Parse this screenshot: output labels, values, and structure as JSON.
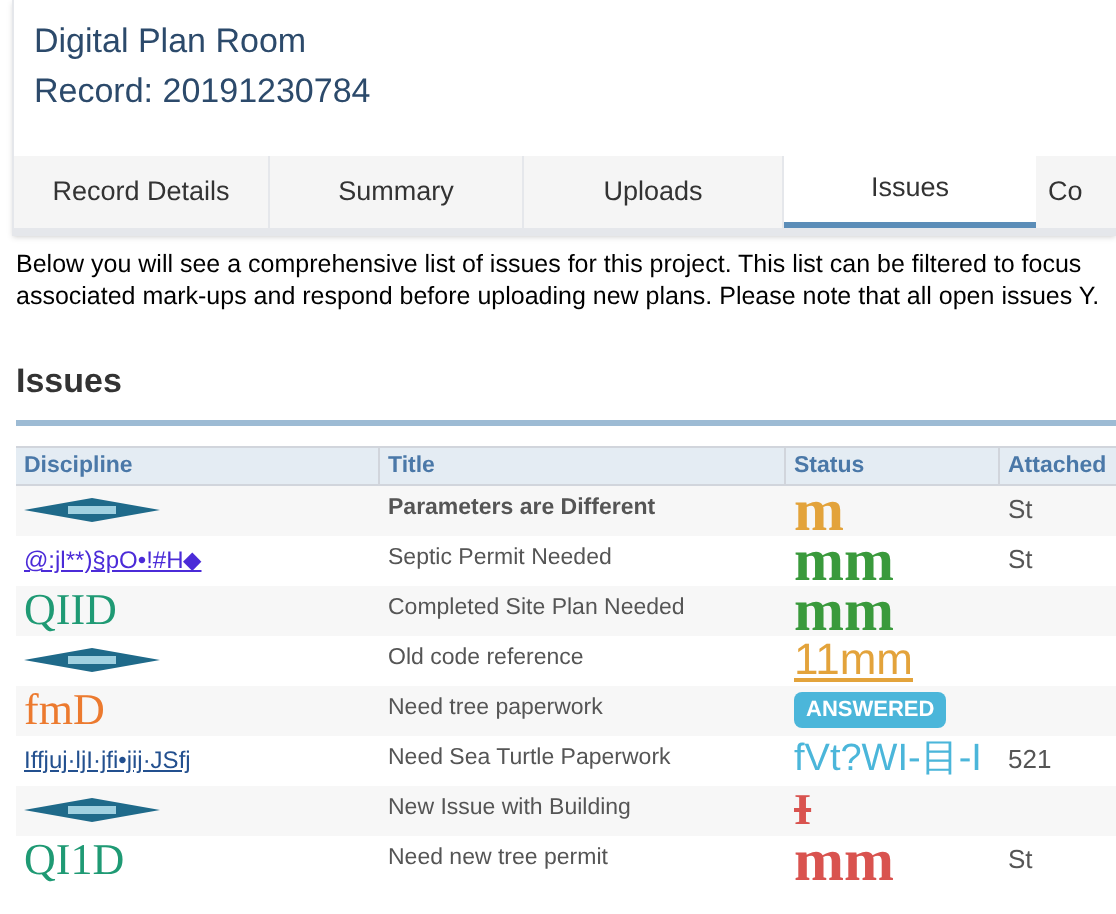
{
  "header": {
    "title": "Digital Plan Room",
    "record": "Record: 20191230784"
  },
  "tabs": [
    {
      "label": "Record Details",
      "selected": false
    },
    {
      "label": "Summary",
      "selected": false
    },
    {
      "label": "Uploads",
      "selected": false
    },
    {
      "label": "Issues",
      "selected": true
    },
    {
      "label": "Co",
      "selected": false
    }
  ],
  "intro": [
    "Below you will see a comprehensive list of issues for this project. This list can be filtered to focus",
    "associated mark-ups and respond before uploading new plans. Please note that all open issues Y."
  ],
  "section_title": "Issues",
  "table": {
    "columns": [
      "Discipline",
      "Title",
      "Status",
      "Attached"
    ],
    "rows": [
      {
        "discipline": {
          "kind": "icon"
        },
        "title": "Parameters are Different",
        "title_bold": true,
        "status": {
          "kind": "serif",
          "text": "m",
          "color": "#e3a33b"
        },
        "attached": "St"
      },
      {
        "discipline": {
          "kind": "link",
          "text": "@:jl**)§pO•!#H◆",
          "color": "#4b2bd8"
        },
        "title": "Septic Permit Needed",
        "title_bold": false,
        "status": {
          "kind": "serif",
          "text": "mm",
          "color": "#3a9a3c"
        },
        "attached": "St"
      },
      {
        "discipline": {
          "kind": "serif",
          "text": "QIID",
          "color": "#1f9a74"
        },
        "title": "Completed Site Plan Needed",
        "title_bold": false,
        "status": {
          "kind": "serif",
          "text": "mm",
          "color": "#3a9a3c"
        }
      },
      {
        "discipline": {
          "kind": "icon"
        },
        "title": "Old code reference",
        "title_bold": false,
        "status": {
          "kind": "underlined",
          "text": "11mm",
          "color": "#e3a33b"
        }
      },
      {
        "discipline": {
          "kind": "serif",
          "text": "fmD",
          "color": "#ec7a2f"
        },
        "title": "Need tree paperwork",
        "title_bold": false,
        "status": {
          "kind": "badge",
          "text": "ANSWERED",
          "color": "#4bb6da"
        }
      },
      {
        "discipline": {
          "kind": "link",
          "text": "Iffjuj·ljI·jfi•jij·JSfj",
          "color": "#23508f"
        },
        "title": "Need Sea Turtle Paperwork",
        "title_bold": false,
        "status": {
          "kind": "sans",
          "text": "fVt?WI-目-I",
          "color": "#4bb6da"
        },
        "attached": "521"
      },
      {
        "discipline": {
          "kind": "icon"
        },
        "title": "New Issue with Building",
        "title_bold": false,
        "status": {
          "kind": "struck",
          "text": "I",
          "color": "#d9534f"
        }
      },
      {
        "discipline": {
          "kind": "serif",
          "text": "QI1D",
          "color": "#1f9a74"
        },
        "title": "Need new tree permit",
        "title_bold": false,
        "status": {
          "kind": "serif",
          "text": "mm",
          "color": "#d9534f"
        },
        "attached": "St"
      }
    ]
  }
}
